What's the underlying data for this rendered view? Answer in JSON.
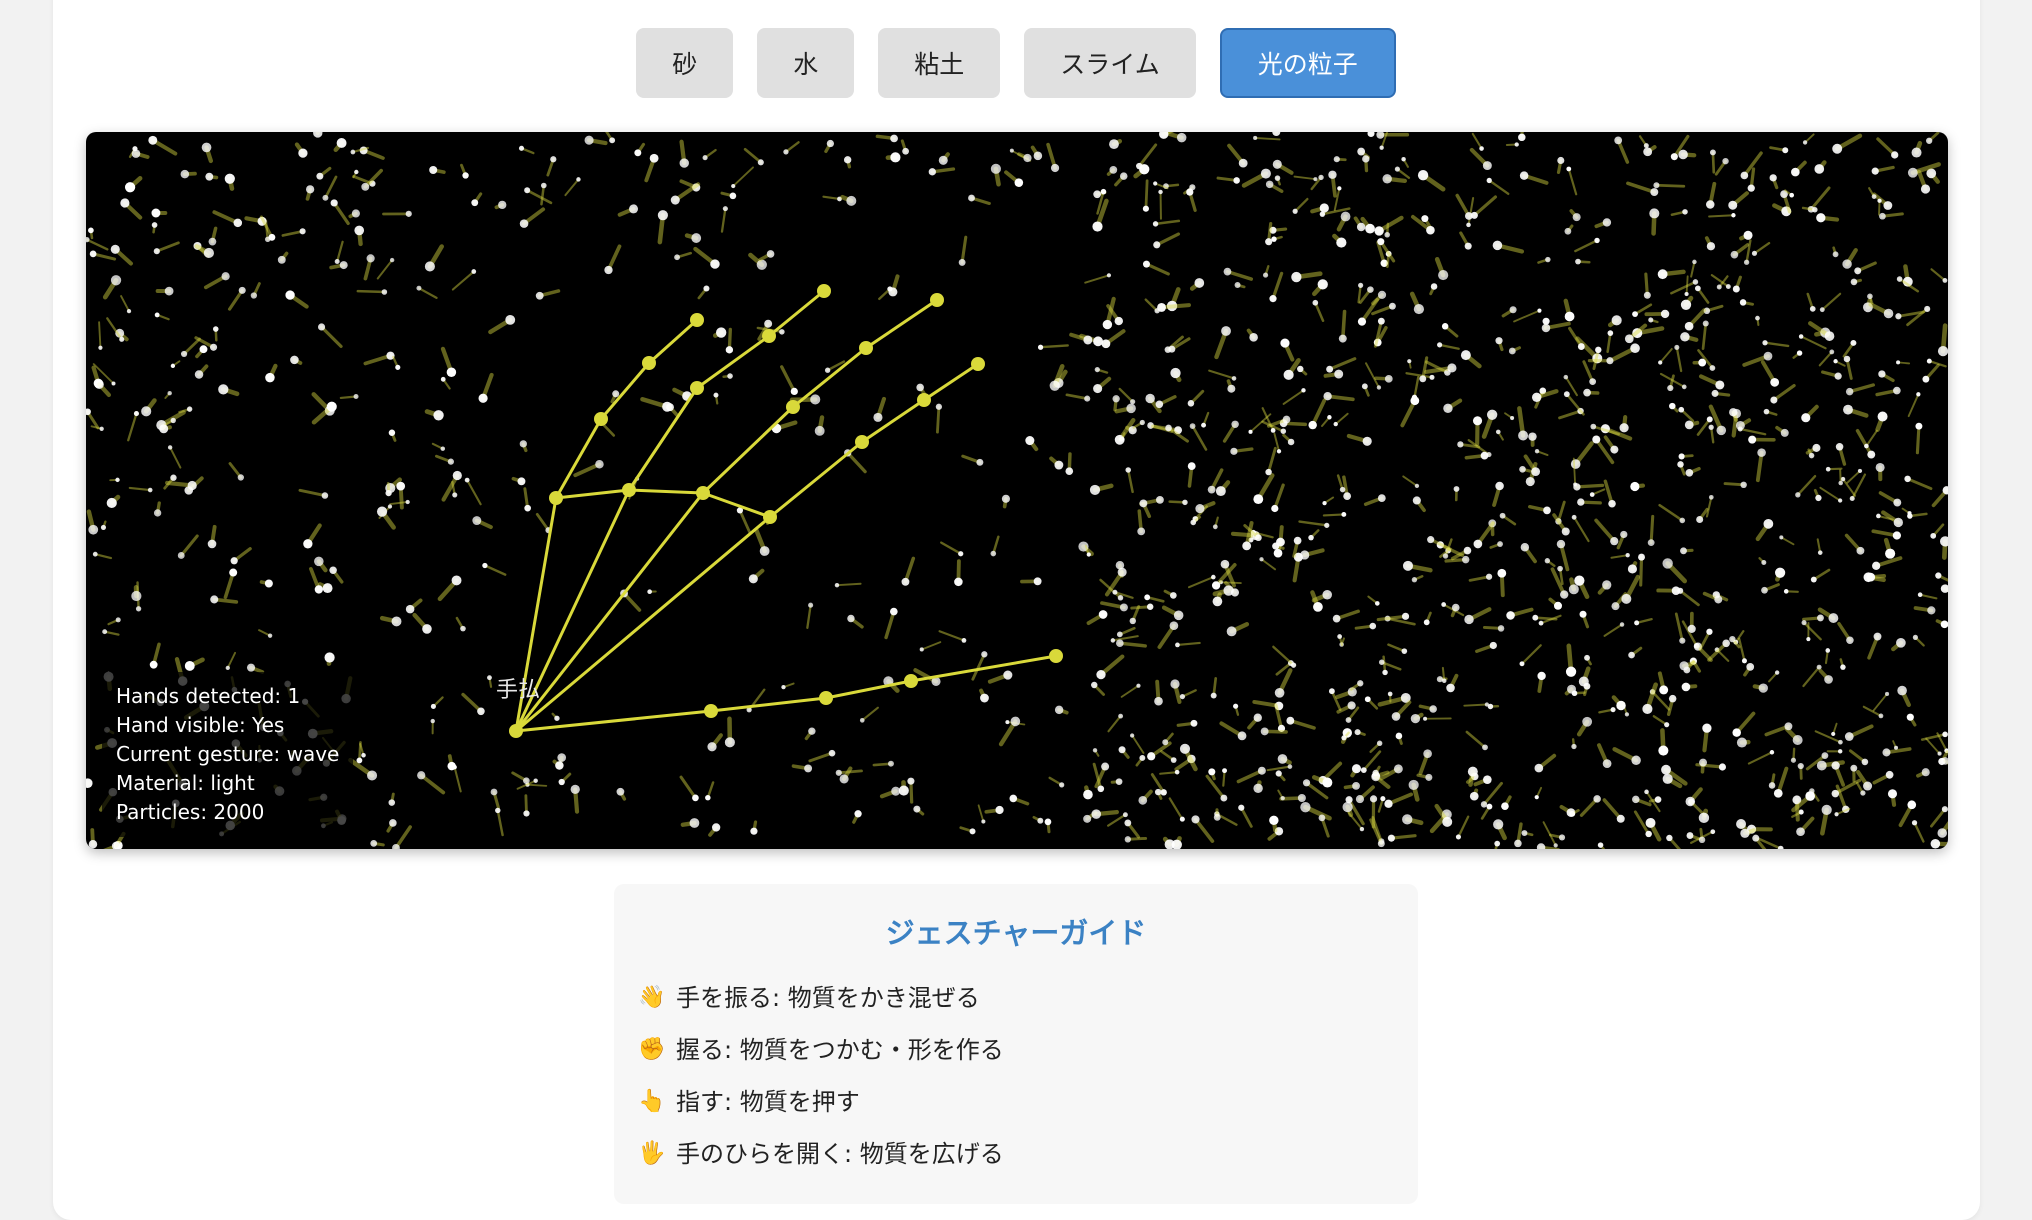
{
  "materials": [
    {
      "label": "砂",
      "active": false
    },
    {
      "label": "水",
      "active": false
    },
    {
      "label": "粘土",
      "active": false
    },
    {
      "label": "スライム",
      "active": false
    },
    {
      "label": "光の粒子",
      "active": true
    }
  ],
  "stage": {
    "hand_label": "手払",
    "background_color": "#000000",
    "particle_color": "#ffffcc",
    "skeleton_color": "#d9d93a"
  },
  "info": {
    "hands_detected": "Hands detected: 1",
    "hand_visible": "Hand visible: Yes",
    "current_gesture": "Current gesture: wave",
    "material": "Material: light",
    "particles": "Particles: 2000"
  },
  "guide": {
    "title": "ジェスチャーガイド",
    "items": [
      {
        "icon": "waving-hand-icon",
        "glyph": "👋",
        "text": "手を振る: 物質をかき混ぜる"
      },
      {
        "icon": "fist-icon",
        "glyph": "✊",
        "text": "握る: 物質をつかむ・形を作る"
      },
      {
        "icon": "pointing-hand-icon",
        "glyph": "👆",
        "text": "指す: 物質を押す"
      },
      {
        "icon": "open-palm-icon",
        "glyph": "🖐",
        "text": "手のひらを開く: 物質を広げる"
      }
    ]
  },
  "colors": {
    "accent": "#4a90d9",
    "guide_title": "#3b82c4"
  }
}
